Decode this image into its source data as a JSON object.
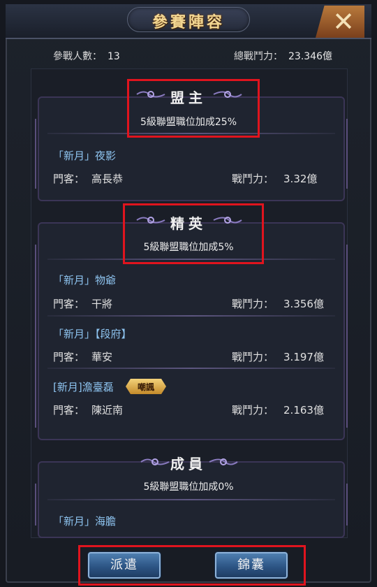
{
  "window": {
    "title": "參賽陣容",
    "close_symbol": "✕"
  },
  "stats": {
    "participants_label": "參戰人數：",
    "participants_value": "13",
    "total_power_label": "總戰鬥力：",
    "total_power_value": "23.346億"
  },
  "sections": [
    {
      "title": "盟主",
      "bonus": "5級聯盟職位加成25%",
      "members": [
        {
          "name": "「新月」夜影",
          "guest_label": "門客：",
          "guest": "高長恭",
          "power_label": "戰鬥力：",
          "power": "3.32億"
        }
      ]
    },
    {
      "title": "精英",
      "bonus": "5級聯盟職位加成5%",
      "members": [
        {
          "name": "「新月」物爺",
          "guest_label": "門客：",
          "guest": "干將",
          "power_label": "戰鬥力：",
          "power": "3.356億"
        },
        {
          "name": "「新月」【段府】",
          "guest_label": "門客：",
          "guest": "華安",
          "power_label": "戰鬥力：",
          "power": "3.197億"
        },
        {
          "name": "[新月]澹臺磊",
          "badge": "嘲諷",
          "guest_label": "門客：",
          "guest": "陳近南",
          "power_label": "戰鬥力：",
          "power": "2.163億"
        }
      ]
    },
    {
      "title": "成員",
      "bonus": "5級聯盟職位加成0%",
      "members": [
        {
          "name": "「新月」海膽"
        }
      ]
    }
  ],
  "buttons": {
    "dispatch": "派遣",
    "kit": "錦囊"
  },
  "colors": {
    "highlight": "#e0141e",
    "name": "#8ec4f0",
    "title_gold": "#f3d792",
    "button": "#2d5585"
  }
}
